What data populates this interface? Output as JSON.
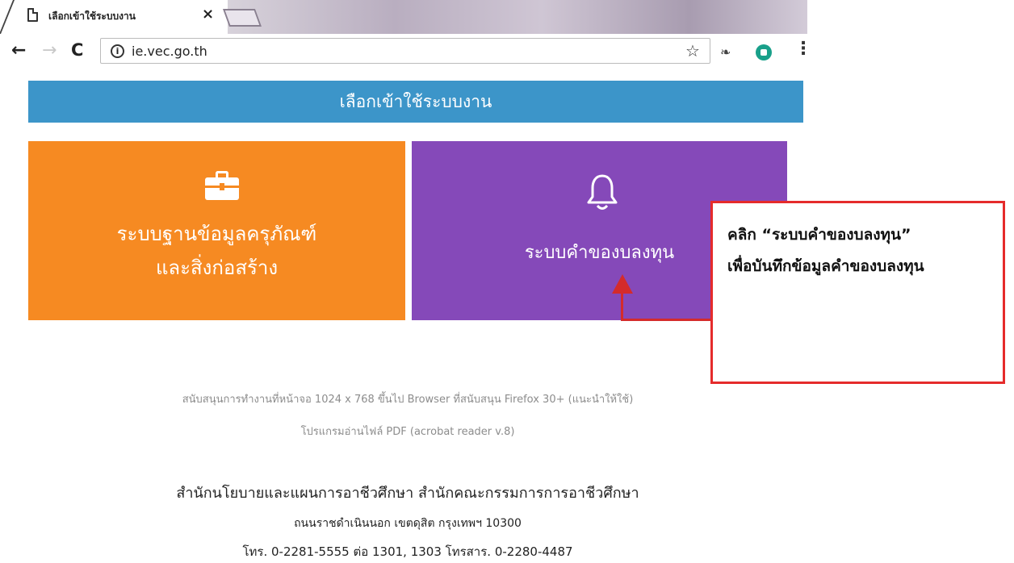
{
  "browser": {
    "tab_title": "เลือกเข้าใช้ระบบงาน",
    "tab_close": "×",
    "url": "ie.vec.go.th"
  },
  "page": {
    "header": "เลือกเข้าใช้ระบบงาน",
    "cards": [
      {
        "label_line1": "ระบบฐานข้อมูลครุภัณฑ์",
        "label_line2": "และสิ่งก่อสร้าง",
        "color": "#f68a22",
        "icon": "briefcase-icon"
      },
      {
        "label_line1": "ระบบคำของบลงทุน",
        "color": "#8549b9",
        "icon": "bell-icon"
      }
    ],
    "support_line1": "สนับสนุนการทำงานที่หน้าจอ 1024 x 768 ขึ้นไป Browser ที่สนับสนุน Firefox 30+ (แนะนำให้ใช้)",
    "support_line2": "โปรแกรมอ่านไฟล์ PDF (acrobat reader v.8)",
    "org_line1": "สำนักนโยบายและแผนการอาชีวศึกษา สำนักคณะกรรมการการอาชีวศึกษา",
    "org_line2": "ถนนราชดำเนินนอก เขตดุสิต กรุงเทพฯ 10300",
    "org_line3": "โทร. 0-2281-5555 ต่อ 1301, 1303 โทรสาร. 0-2280-4487"
  },
  "annotation": {
    "line1": "คลิก “ระบบคำของบลงทุน”",
    "line2": "เพื่อบันทึกข้อมูลคำของบลงทุน",
    "color": "#e52b2b"
  }
}
